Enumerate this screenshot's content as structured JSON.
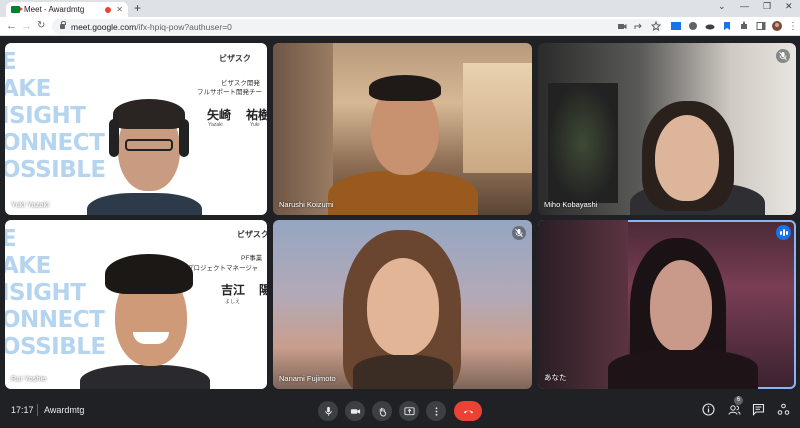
{
  "browser": {
    "tab_title": "Meet - Awardmtg",
    "new_tab_label": "+",
    "url_host": "meet.google.com",
    "url_path": "/ifx-hpiq-pow?authuser=0"
  },
  "tiles": [
    {
      "name": "Yuki Yazaki",
      "muted": false,
      "slide": {
        "lines": [
          "E",
          "AKE",
          "ISIGHT",
          "ONNECT",
          "OSSIBLE"
        ],
        "company": "ビザスク",
        "dept": "ビザスク開発",
        "team": "フルサポート開発チー",
        "person_jp": "矢崎",
        "person_jp2": "祐樹",
        "person_romaji": "Yazaki",
        "person_romaji2": "Yuki"
      }
    },
    {
      "name": "Narushi Koizumi",
      "muted": false
    },
    {
      "name": "Miho Kobayashi",
      "muted": true
    },
    {
      "name": "Rui Yoshie",
      "muted": false,
      "slide": {
        "lines": [
          "E",
          "AKE",
          "ISIGHT",
          "ONNECT",
          "OSSIBLE"
        ],
        "company": "ビザスク",
        "dept": "PF事業",
        "team": "プロジェクトマネージャ",
        "person_jp": "吉江",
        "person_jp2": "陽",
        "person_romaji": "よしえ"
      }
    },
    {
      "name": "Nanami Fujimoto",
      "muted": true
    },
    {
      "name": "あなた",
      "muted": false,
      "speaking": true
    }
  ],
  "bottom_bar": {
    "time": "17:17",
    "meeting_name": "Awardmtg",
    "participant_count": "6"
  },
  "colors": {
    "hangup": "#ea4335",
    "active_border": "#8ab4f8",
    "speaking": "#1a73e8"
  }
}
